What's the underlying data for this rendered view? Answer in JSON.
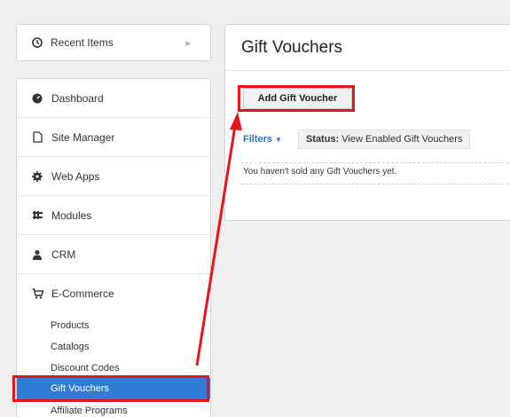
{
  "recent": {
    "label": "Recent Items",
    "icon": "clock-icon"
  },
  "nav": {
    "items": [
      {
        "label": "Dashboard",
        "icon": "dashboard-icon"
      },
      {
        "label": "Site Manager",
        "icon": "file-icon"
      },
      {
        "label": "Web Apps",
        "icon": "gear-icon"
      },
      {
        "label": "Modules",
        "icon": "modules-icon"
      },
      {
        "label": "CRM",
        "icon": "user-icon"
      },
      {
        "label": "E-Commerce",
        "icon": "cart-icon"
      }
    ],
    "ecommerce_sub": [
      "Products",
      "Catalogs",
      "Discount Codes",
      "Gift Vouchers",
      "Affiliate Programs"
    ],
    "active_sub": "Gift Vouchers"
  },
  "main": {
    "title": "Gift Vouchers",
    "add_button": "Add Gift Voucher",
    "filters_label": "Filters",
    "status_label": "Status:",
    "status_value": "View Enabled Gift Vouchers",
    "empty_message": "You haven't sold any Gift Vouchers yet."
  },
  "colors": {
    "accent": "#2f7bd6",
    "highlight": "#e8141b"
  }
}
